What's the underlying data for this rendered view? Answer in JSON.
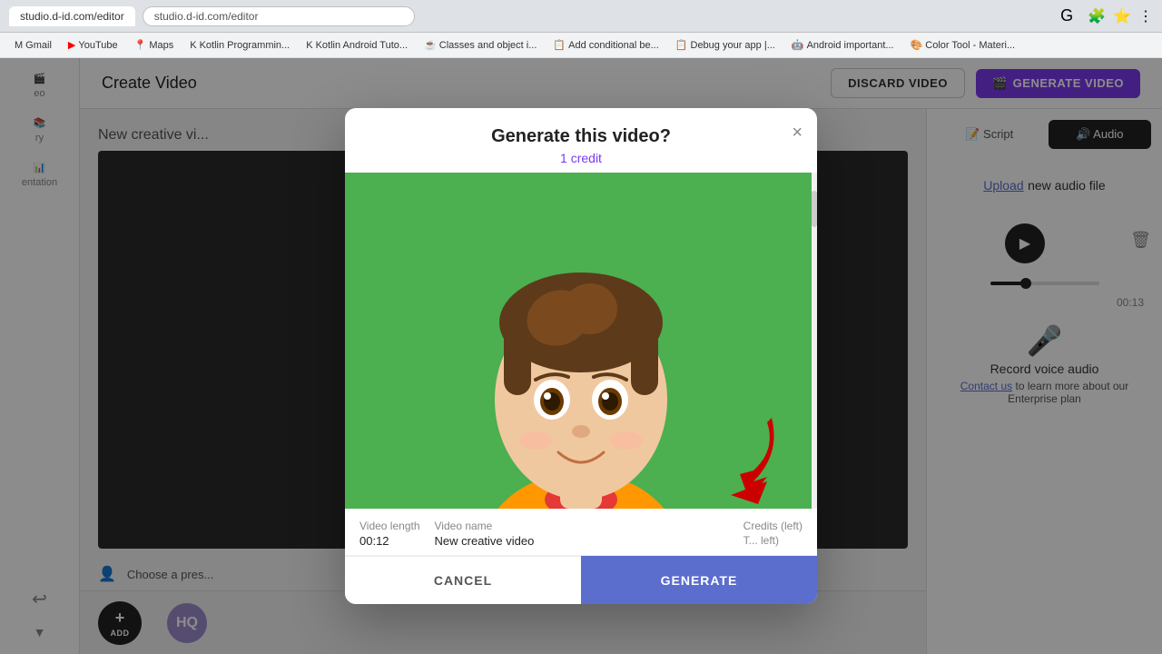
{
  "browser": {
    "url": "studio.d-id.com/editor",
    "tab_label": "studio.d-id.com/editor"
  },
  "bookmarks": [
    {
      "label": "Gmail",
      "icon": "M"
    },
    {
      "label": "YouTube",
      "icon": "▶"
    },
    {
      "label": "Maps",
      "icon": "📍"
    },
    {
      "label": "Kotlin Programmin...",
      "icon": "K"
    },
    {
      "label": "Kotlin Android Tuto...",
      "icon": "K"
    },
    {
      "label": "Classes and object i...",
      "icon": "☕"
    },
    {
      "label": "Add conditional be...",
      "icon": "📋"
    },
    {
      "label": "Debug your app |...",
      "icon": "📋"
    },
    {
      "label": "Android important...",
      "icon": "🤖"
    },
    {
      "label": "Color Tool - Materi...",
      "icon": "🎨"
    }
  ],
  "page": {
    "title": "Create Video"
  },
  "top_bar": {
    "discard_label": "DISCARD VIDEO",
    "generate_label": "GENERATE VIDEO"
  },
  "sidebar": {
    "items": [
      {
        "label": "eo",
        "icon": "🎬"
      },
      {
        "label": "ry",
        "icon": "📚"
      },
      {
        "label": "entation",
        "icon": "📊"
      }
    ],
    "bottom_items": [
      {
        "label": "↩",
        "icon": "↩"
      }
    ]
  },
  "canvas": {
    "label": "New creative vi...",
    "presenter_label": "Choose a pres..."
  },
  "timeline": {
    "add_label": "ADD"
  },
  "right_panel": {
    "tabs": [
      {
        "label": "Script",
        "active": false
      },
      {
        "label": "Audio",
        "active": true
      }
    ],
    "upload_link": "Upload",
    "upload_text": "new audio file",
    "audio_time": "00:13",
    "record_label": "Record voice audio",
    "contact_text": "Contact us",
    "contact_suffix": "to learn more about our Enterprise plan"
  },
  "modal": {
    "title": "Generate this video?",
    "close_label": "×",
    "credit_label": "1 credit",
    "video_length_label": "Video length",
    "video_length_value": "00:12",
    "video_name_label": "Video name",
    "video_name_value": "New creative video",
    "credits_label": "Credits (left)",
    "credits_value": "T... left)",
    "cancel_label": "CANCEL",
    "generate_label": "GENERATE"
  },
  "avatar": {
    "initials": "HQ",
    "bg_color": "#9b8acc"
  }
}
